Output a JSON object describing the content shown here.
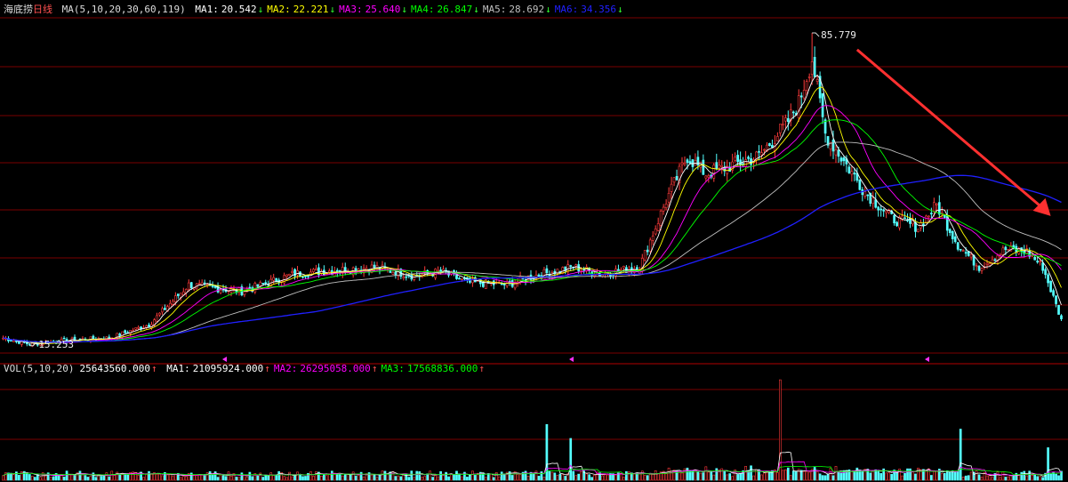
{
  "header": {
    "stock_name": "海底捞",
    "period": "日线",
    "ma_label": "MA(5,10,20,30,60,119)",
    "ma_values": [
      {
        "label": "MA1:",
        "value": "20.542",
        "arrow": "↓",
        "color": "#ffffff"
      },
      {
        "label": "MA2:",
        "value": "22.221",
        "arrow": "↓",
        "color": "#ffff00"
      },
      {
        "label": "MA3:",
        "value": "25.640",
        "arrow": "↓",
        "color": "#ff00ff"
      },
      {
        "label": "MA4:",
        "value": "26.847",
        "arrow": "↓",
        "color": "#00ff00"
      },
      {
        "label": "MA5:",
        "value": "28.692",
        "arrow": "↓",
        "color": "#c0c0c0"
      },
      {
        "label": "MA6:",
        "value": "34.356",
        "arrow": "↓",
        "color": "#2020ff"
      }
    ]
  },
  "volume_header": {
    "label": "VOL(5,10,20)",
    "value": "25643560.000",
    "arrow": "↑",
    "mas": [
      {
        "label": "MA1:",
        "value": "21095924.000",
        "arrow": "↑",
        "color": "#ffffff"
      },
      {
        "label": "MA2:",
        "value": "26295058.000",
        "arrow": "↑",
        "color": "#ff00ff"
      },
      {
        "label": "MA3:",
        "value": "17568836.000",
        "arrow": "↑",
        "color": "#00ff00"
      }
    ]
  },
  "colors": {
    "up": "#ff3b3b",
    "down": "#54ffff",
    "grid": "#7a0000",
    "trend_arrow": "#ff3030",
    "text_red": "#ff5050"
  },
  "chart_data": {
    "type": "candlestick",
    "ylim": [
      14.0,
      90.0
    ],
    "annotations": [
      {
        "text": "85.779",
        "at_index": 305,
        "value": 85.779,
        "kind": "high"
      },
      {
        "text": "15.253",
        "at_index": 10,
        "value": 15.253,
        "kind": "low"
      }
    ],
    "trend_arrow": {
      "from_index": 322,
      "from_value": 82.0,
      "to_index": 395,
      "to_value": 44.5
    },
    "close_anchors": [
      [
        0,
        17.0
      ],
      [
        10,
        15.6
      ],
      [
        25,
        16.5
      ],
      [
        40,
        17.0
      ],
      [
        55,
        20.0
      ],
      [
        70,
        29.0
      ],
      [
        90,
        27.5
      ],
      [
        110,
        31.5
      ],
      [
        130,
        32.5
      ],
      [
        140,
        33.0
      ],
      [
        155,
        31.0
      ],
      [
        165,
        32.0
      ],
      [
        175,
        29.5
      ],
      [
        190,
        29.0
      ],
      [
        200,
        31.0
      ],
      [
        215,
        33.0
      ],
      [
        225,
        31.5
      ],
      [
        240,
        33.0
      ],
      [
        250,
        48.0
      ],
      [
        258,
        58.0
      ],
      [
        265,
        54.0
      ],
      [
        275,
        56.0
      ],
      [
        285,
        58.0
      ],
      [
        295,
        65.0
      ],
      [
        300,
        70.0
      ],
      [
        305,
        80.0
      ],
      [
        310,
        63.0
      ],
      [
        318,
        56.0
      ],
      [
        325,
        50.0
      ],
      [
        335,
        44.0
      ],
      [
        345,
        42.0
      ],
      [
        352,
        47.0
      ],
      [
        360,
        38.0
      ],
      [
        368,
        33.0
      ],
      [
        378,
        37.0
      ],
      [
        386,
        36.5
      ],
      [
        392,
        33.0
      ],
      [
        399,
        21.0
      ]
    ],
    "volume_spikes": [
      {
        "index": 205,
        "value": 60
      },
      {
        "index": 214,
        "value": 45
      },
      {
        "index": 293,
        "value": 108
      },
      {
        "index": 361,
        "value": 55
      },
      {
        "index": 394,
        "value": 35
      }
    ]
  }
}
